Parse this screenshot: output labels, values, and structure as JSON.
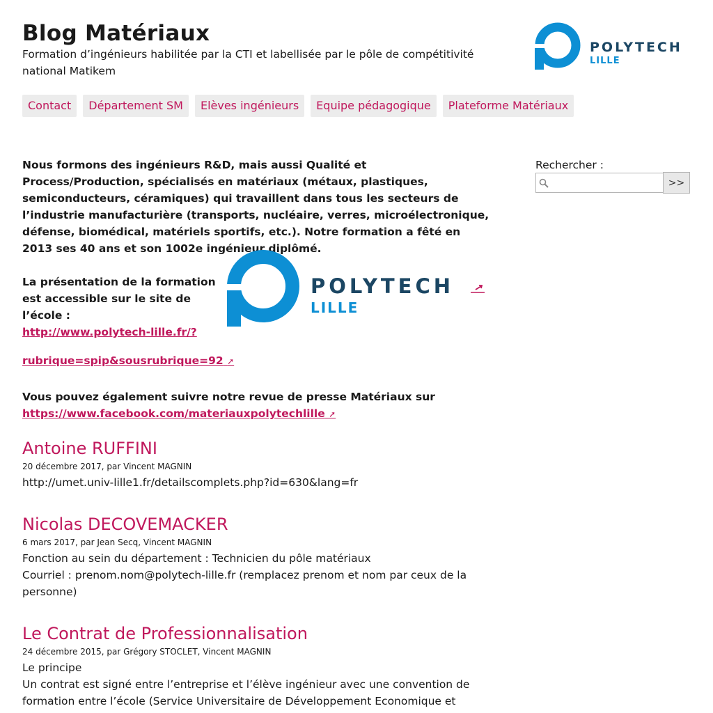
{
  "header": {
    "title": "Blog Matériaux",
    "description": "Formation d’ingénieurs habilitée par la CTI et labellisée par le pôle de compétitivité national Matikem",
    "logo_text": "POLYTECH",
    "logo_subtext": "LILLE"
  },
  "nav": {
    "items": [
      "Contact",
      "Département SM",
      "Elèves ingénieurs",
      "Equipe pédagogique",
      "Plateforme Matériaux"
    ]
  },
  "intro": {
    "paragraph1": "Nous formons des ingénieurs R&D, mais aussi Qualité et Process/Production, spécialisés en matériaux (métaux, plastiques, semiconducteurs, céramiques) qui travaillent dans tous les secteurs de l’industrie manufacturière (transports, nucléaire, verres, microélectronique, défense, biomédical, matériels sportifs, etc.). Notre formation a fêté en 2013 ses 40 ans et son 1002e ingénieur diplômé.",
    "presentation_text": "La présentation de la formation est accessible sur le site de l’école :",
    "presentation_url_part1": "http://www.polytech-lille.fr/?",
    "presentation_url_part2": "rubrique=spip&sousrubrique=92",
    "press_text": "Vous pouvez également suivre notre revue de presse Matériaux sur",
    "press_url": "https://www.facebook.com/materiauxpolytechlille",
    "logo_text": "POLYTECH",
    "logo_subtext": "LILLE"
  },
  "posts": [
    {
      "title": "Antoine RUFFINI",
      "meta": "20 décembre 2017, par Vincent MAGNIN",
      "lines": [
        "http://umet.univ-lille1.fr/detailscomplets.php?id=630&lang=fr"
      ]
    },
    {
      "title": "Nicolas DECOVEMACKER",
      "meta": "6 mars 2017, par Jean Secq, Vincent MAGNIN",
      "lines": [
        "Fonction au sein du département : Technicien du pôle matériaux",
        "Courriel : prenom.nom@polytech-lille.fr (remplacez prenom et nom par ceux de la personne)"
      ]
    },
    {
      "title": "Le Contrat de Professionnalisation",
      "meta": "24 décembre 2015, par Grégory STOCLET, Vincent MAGNIN",
      "lines": [
        "Le principe",
        "Un contrat est signé entre l’entreprise et l’élève ingénieur avec une convention de formation entre l’école (Service Universitaire de Développement Economique et"
      ]
    }
  ],
  "search": {
    "label": "Rechercher :",
    "value": "",
    "button_label": ">>"
  },
  "colors": {
    "accent": "#c0185c",
    "logo_blue": "#0d8fd4",
    "logo_dark": "#1b4663",
    "nav_bg": "#ececec"
  },
  "icons": {
    "search": "magnifier-icon",
    "external_link": "external-link-arrow-icon"
  }
}
